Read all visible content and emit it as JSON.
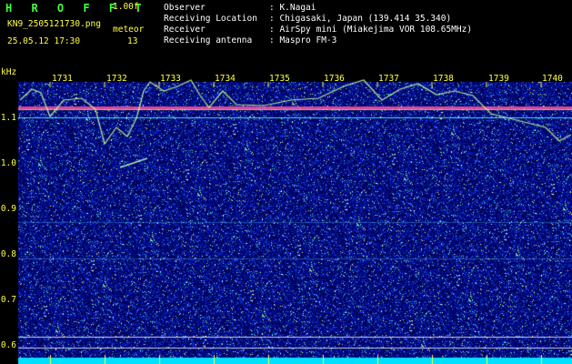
{
  "header": {
    "app_name": "H R O F F T",
    "version": "1.00f",
    "filename": "KN9_2505121730.png",
    "mode_label": "meteor",
    "datetime": "25.05.12 17:30",
    "count": "13",
    "fields": [
      {
        "label": "Observer",
        "value": ": K.Nagai"
      },
      {
        "label": "Receiving Location",
        "value": ": Chigasaki, Japan (139.414 35.340)"
      },
      {
        "label": "Receiver",
        "value": ": AirSpy mini (Miakejima VOR 108.65MHz)"
      },
      {
        "label": "Receiving antenna",
        "value": ": Maspro FM-3"
      }
    ]
  },
  "chart_data": {
    "type": "heatmap",
    "ylabel": "kHz",
    "y_ticks": [
      "1.1",
      "1.0",
      "0.9",
      "0.8",
      "0.7",
      "0.6"
    ],
    "time_ticks": [
      "1731",
      "1732",
      "1733",
      "1734",
      "1735",
      "1736",
      "1737",
      "1738",
      "1739",
      "1740"
    ],
    "colors": {
      "background": "#000080",
      "noise": "#3050ff",
      "carrier": "#ff40a0",
      "trace": "#ffff80",
      "baseline": "#00e0ff"
    }
  }
}
